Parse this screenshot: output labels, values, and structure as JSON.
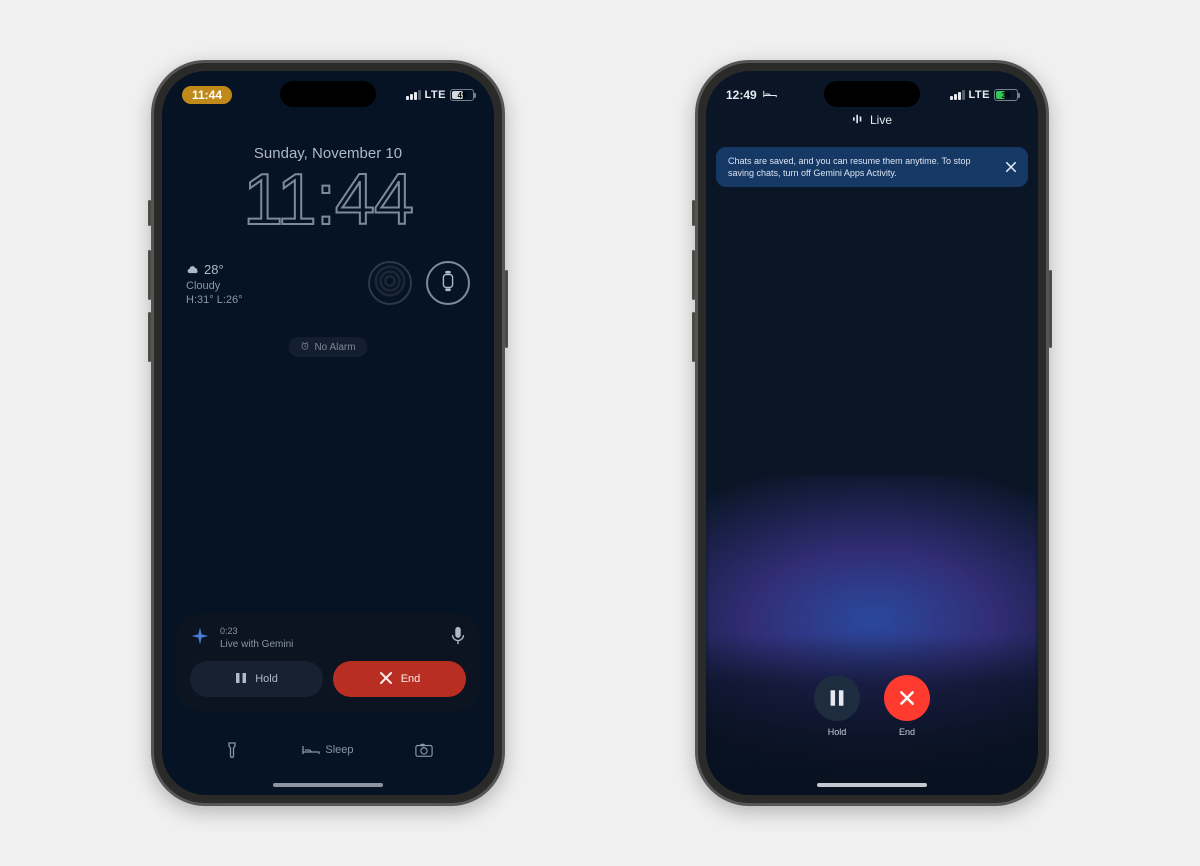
{
  "left": {
    "status": {
      "time": "11:44",
      "network": "LTE",
      "battery_pct": "49"
    },
    "date": "Sunday, November 10",
    "clock": "11:44",
    "weather": {
      "temp": "28°",
      "cond": "Cloudy",
      "hi": "H:31°",
      "lo": "L:26°"
    },
    "alarm": "No Alarm",
    "live": {
      "duration": "0:23",
      "title": "Live with Gemini",
      "hold": "Hold",
      "end": "End"
    },
    "dock": {
      "sleep": "Sleep"
    }
  },
  "right": {
    "status": {
      "time": "12:49",
      "network": "LTE",
      "battery_pct": "39"
    },
    "header": "Live",
    "banner": "Chats are saved, and you can resume them anytime. To stop saving chats, turn off Gemini Apps Activity.",
    "controls": {
      "hold": "Hold",
      "end": "End"
    }
  }
}
